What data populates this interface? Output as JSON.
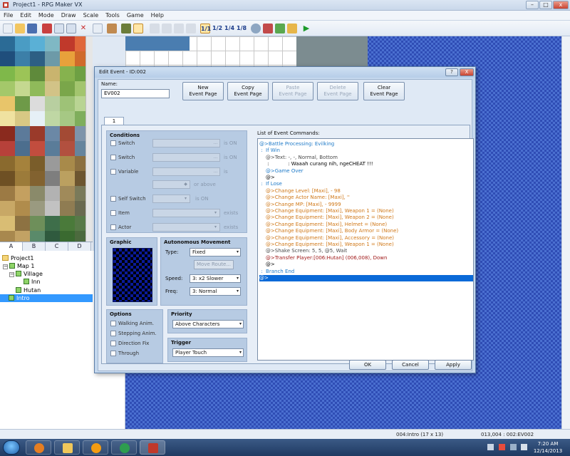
{
  "window": {
    "title": "Project1 - RPG Maker VX"
  },
  "menu": [
    "File",
    "Edit",
    "Mode",
    "Draw",
    "Scale",
    "Tools",
    "Game",
    "Help"
  ],
  "toolbar": {
    "scale_buttons": [
      "1/1",
      "1/2",
      "1/4",
      "1/8"
    ]
  },
  "tileset_tabs": [
    "A",
    "B",
    "C",
    "D"
  ],
  "map_tree": [
    {
      "label": "Project1",
      "depth": 0,
      "icon": "folder-icon"
    },
    {
      "label": "Map 1",
      "depth": 1,
      "icon": "map-icon",
      "toggle": "−"
    },
    {
      "label": "Village",
      "depth": 2,
      "icon": "map-icon",
      "toggle": "−"
    },
    {
      "label": "Inn",
      "depth": 3,
      "icon": "map-icon"
    },
    {
      "label": "Hutan",
      "depth": 2,
      "icon": "map-icon"
    },
    {
      "label": "Intro",
      "depth": 1,
      "icon": "map-icon",
      "selected": true
    }
  ],
  "status": {
    "map": "004:Intro (17 x 13)",
    "pos": "013,004 : 002:EV002"
  },
  "clock": {
    "time": "7:20 AM",
    "date": "12/14/2013"
  },
  "dialog": {
    "title": "Edit Event - ID:002",
    "help": "?",
    "close": "X",
    "name_label": "Name:",
    "name_value": "EV002",
    "buttons": [
      {
        "label": "New\nEvent Page",
        "enabled": true
      },
      {
        "label": "Copy\nEvent Page",
        "enabled": true
      },
      {
        "label": "Paste\nEvent Page",
        "enabled": false
      },
      {
        "label": "Delete\nEvent Page",
        "enabled": false
      },
      {
        "label": "Clear\nEvent Page",
        "enabled": true
      }
    ],
    "page_tab": "1",
    "conditions": {
      "title": "Conditions",
      "switch1": "Switch",
      "switch2": "Switch",
      "variable": "Variable",
      "self_switch": "Self Switch",
      "item": "Item",
      "actor": "Actor",
      "is_on1": "is ON",
      "is_on2": "is ON",
      "is": "is",
      "or_above": "or above",
      "is_on3": "is ON",
      "exists1": "exists",
      "exists2": "exists"
    },
    "graphic": {
      "title": "Graphic"
    },
    "movement": {
      "title": "Autonomous Movement",
      "type_label": "Type:",
      "type_value": "Fixed",
      "move_route": "Move Route...",
      "speed_label": "Speed:",
      "speed_value": "3: x2 Slower",
      "freq_label": "Freq:",
      "freq_value": "3: Normal"
    },
    "options": {
      "title": "Options",
      "items": [
        "Walking Anim.",
        "Stepping Anim.",
        "Direction Fix",
        "Through"
      ]
    },
    "priority": {
      "title": "Priority",
      "value": "Above Characters"
    },
    "trigger": {
      "title": "Trigger",
      "value": "Player Touch"
    },
    "commands_label": "List of Event Commands:",
    "commands": [
      {
        "text": "@>Battle Processing: Evilking",
        "color": "#1e7ac8"
      },
      {
        "text": " :  If Win",
        "color": "#1e7ac8"
      },
      {
        "text": "    @>Text: -, -, Normal, Bottom",
        "color": "#4a4a4a"
      },
      {
        "text": "     :            : Waaah curang nih, ngeCHEAT !!!",
        "color": "#000"
      },
      {
        "text": "    @>Game Over",
        "color": "#1e7ac8"
      },
      {
        "text": "    @>",
        "color": "#000"
      },
      {
        "text": " :  If Lose",
        "color": "#1e7ac8"
      },
      {
        "text": "    @>Change Level: [Maxi], - 98",
        "color": "#d07818"
      },
      {
        "text": "    @>Change Actor Name: [Maxi], ''",
        "color": "#d07818"
      },
      {
        "text": "    @>Change MP: [Maxi], - 9999",
        "color": "#d07818"
      },
      {
        "text": "    @>Change Equipment: [Maxi], Weapon 1 = (None)",
        "color": "#d07818"
      },
      {
        "text": "    @>Change Equipment: [Maxi], Weapon 2 = (None)",
        "color": "#d07818"
      },
      {
        "text": "    @>Change Equipment: [Maxi], Helmet = (None)",
        "color": "#d07818"
      },
      {
        "text": "    @>Change Equipment: [Maxi], Body Armor = (None)",
        "color": "#d07818"
      },
      {
        "text": "    @>Change Equipment: [Maxi], Accessory = (None)",
        "color": "#d07818"
      },
      {
        "text": "    @>Change Equipment: [Maxi], Weapon 1 = (None)",
        "color": "#d07818"
      },
      {
        "text": "    @>Shake Screen: 5, 5, @5, Wait",
        "color": "#4a4a4a"
      },
      {
        "text": "    @>Transfer Player:[006:Hutan] (006,008), Down",
        "color": "#a01818"
      },
      {
        "text": "    @>",
        "color": "#000"
      },
      {
        "text": " :  Branch End",
        "color": "#1e7ac8"
      },
      {
        "text": "@>",
        "color": "#000",
        "selected": true
      }
    ],
    "ok": "OK",
    "cancel": "Cancel",
    "apply": "Apply"
  }
}
